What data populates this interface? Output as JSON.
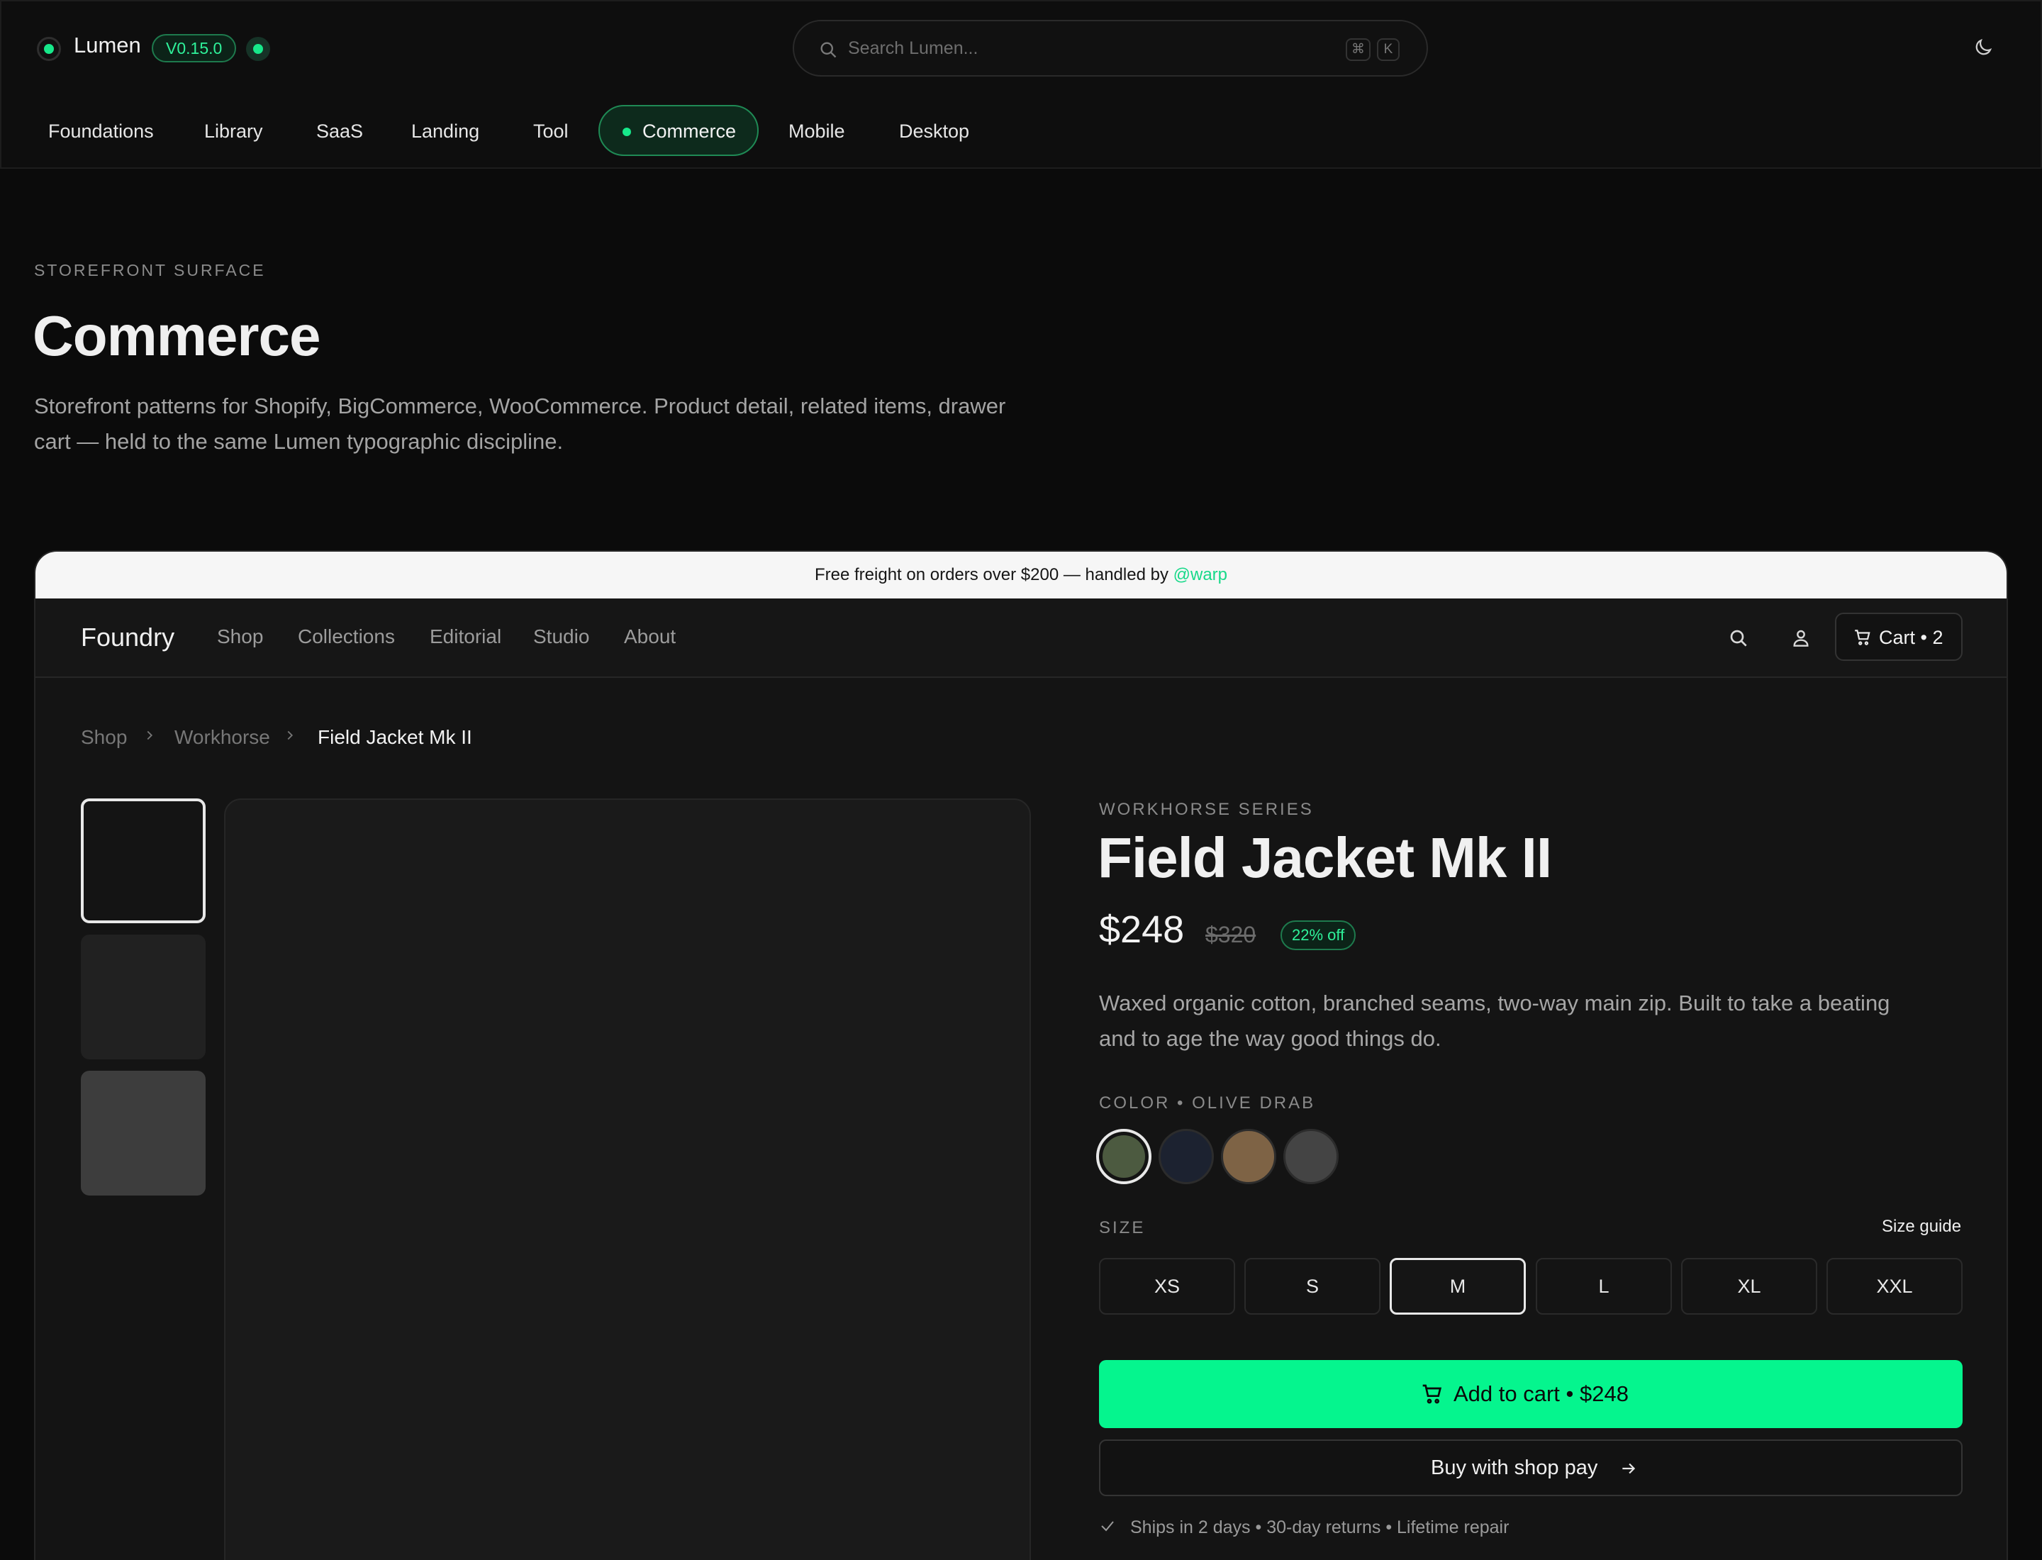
{
  "app": {
    "name": "Lumen",
    "version": "V0.15.0",
    "search_placeholder": "Search Lumen...",
    "search_shortcut": [
      "⌘",
      "K"
    ],
    "theme_icon": "moon-icon",
    "colors": {
      "accent": "#17e88a",
      "background": "#0b0b0b",
      "cta": "#05f58e"
    }
  },
  "categories": {
    "items": [
      "Foundations",
      "Library",
      "SaaS",
      "Landing",
      "Tool",
      "Commerce",
      "Mobile",
      "Desktop"
    ],
    "active": "Commerce"
  },
  "hero": {
    "eyebrow": "STOREFRONT SURFACE",
    "title": "Commerce",
    "description": "Storefront patterns for Shopify, BigCommerce, WooCommerce. Product detail, related items, drawer cart — held to the same Lumen typographic discipline."
  },
  "store": {
    "announcement_text": "Free freight on orders over $200 — handled by ",
    "announcement_handle": "@warp",
    "logo": "Foundry",
    "nav": [
      "Shop",
      "Collections",
      "Editorial",
      "Studio",
      "About"
    ],
    "icons": [
      "search-icon",
      "user-icon",
      "cart-icon"
    ],
    "cart_label": "Cart • 2",
    "breadcrumb": [
      "Shop",
      "Workhorse",
      "Field Jacket Mk II"
    ]
  },
  "product": {
    "series": "WORKHORSE SERIES",
    "title": "Field Jacket Mk II",
    "price": "$248",
    "compare_price": "$320",
    "discount": "22% off",
    "description": "Waxed organic cotton, branched seams, two-way main zip. Built to take a beating and to age the way good things do.",
    "color_label": "COLOR • OLIVE DRAB",
    "swatches": [
      {
        "color": "#4c5a40",
        "selected": true
      },
      {
        "color": "#1c2230",
        "selected": false
      },
      {
        "color": "#7e6345",
        "selected": false
      },
      {
        "color": "#444444",
        "selected": false
      }
    ],
    "size_label": "SIZE",
    "size_guide": "Size guide",
    "sizes": [
      "XS",
      "S",
      "M",
      "L",
      "XL",
      "XXL"
    ],
    "selected_size": "M",
    "add_to_cart": "Add to cart • $248",
    "shop_pay": "Buy with shop pay",
    "ships": "Ships in 2 days • 30-day returns • Lifetime repair"
  }
}
